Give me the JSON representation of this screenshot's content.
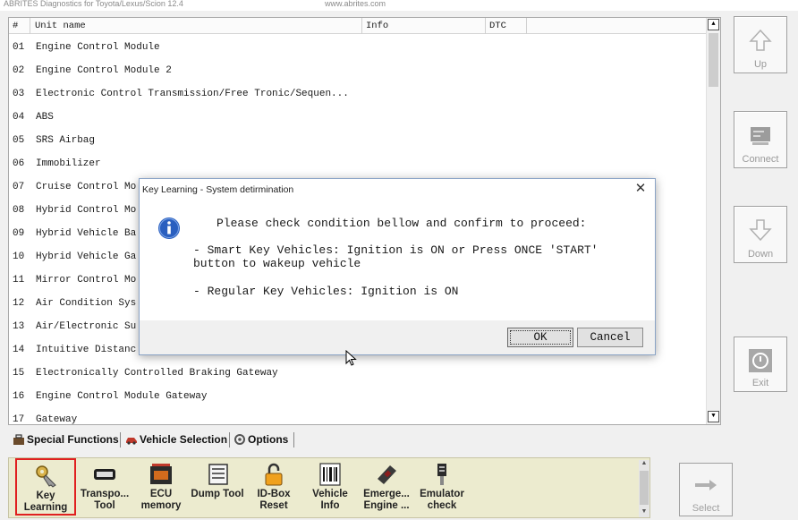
{
  "window": {
    "title": "ABRITES Diagnostics for Toyota/Lexus/Scion 12.4",
    "url": "www.abrites.com"
  },
  "list": {
    "headers": [
      "#",
      "Unit name",
      "Info",
      "DTC"
    ],
    "rows": [
      {
        "num": "01",
        "name": "Engine Control Module"
      },
      {
        "num": "02",
        "name": "Engine Control Module 2"
      },
      {
        "num": "03",
        "name": "Electronic Control Transmission/Free Tronic/Sequen..."
      },
      {
        "num": "04",
        "name": "ABS"
      },
      {
        "num": "05",
        "name": "SRS Airbag"
      },
      {
        "num": "06",
        "name": "Immobilizer"
      },
      {
        "num": "07",
        "name": "Cruise Control Mo"
      },
      {
        "num": "08",
        "name": "Hybrid Control Mo"
      },
      {
        "num": "09",
        "name": "Hybrid Vehicle Ba"
      },
      {
        "num": "10",
        "name": "Hybrid Vehicle Ga"
      },
      {
        "num": "11",
        "name": "Mirror Control Mo"
      },
      {
        "num": "12",
        "name": "Air Condition Sys"
      },
      {
        "num": "13",
        "name": "Air/Electronic Su"
      },
      {
        "num": "14",
        "name": "Intuitive Distanc"
      },
      {
        "num": "15",
        "name": "Electronically Controlled Braking Gateway"
      },
      {
        "num": "16",
        "name": "Engine Control Module Gateway"
      },
      {
        "num": "17",
        "name": "Gateway"
      }
    ]
  },
  "side_buttons": {
    "up": "Up",
    "connect": "Connect",
    "down": "Down",
    "exit": "Exit",
    "select": "Select"
  },
  "tabs": [
    "Special Functions",
    "Vehicle Selection",
    "Options"
  ],
  "tools": [
    {
      "label": "Key\nLearning",
      "icon": "key-icon",
      "selected": true
    },
    {
      "label": "Transpo...\nTool",
      "icon": "transponder-icon"
    },
    {
      "label": "ECU\nmemory",
      "icon": "ecu-icon"
    },
    {
      "label": "Dump Tool",
      "icon": "chip-icon"
    },
    {
      "label": "ID-Box\nReset",
      "icon": "padlock-icon"
    },
    {
      "label": "Vehicle\nInfo",
      "icon": "barcode-icon"
    },
    {
      "label": "Emerge...\nEngine ...",
      "icon": "emergency-key-icon"
    },
    {
      "label": "Emulator\ncheck",
      "icon": "emulator-icon"
    }
  ],
  "dialog": {
    "title": "Key Learning - System detirmination",
    "line1": "Please check condition bellow and confirm to proceed:",
    "line2": "- Smart Key Vehicles: Ignition is ON or Press ONCE 'START'\nbutton to wakeup vehicle",
    "line3": "- Regular Key Vehicles: Ignition is ON",
    "ok": "OK",
    "cancel": "Cancel"
  },
  "colors": {
    "toolbar_bg": "#ecebcf",
    "selected_outline": "#e02020",
    "info_icon": "#2a5fbf"
  }
}
